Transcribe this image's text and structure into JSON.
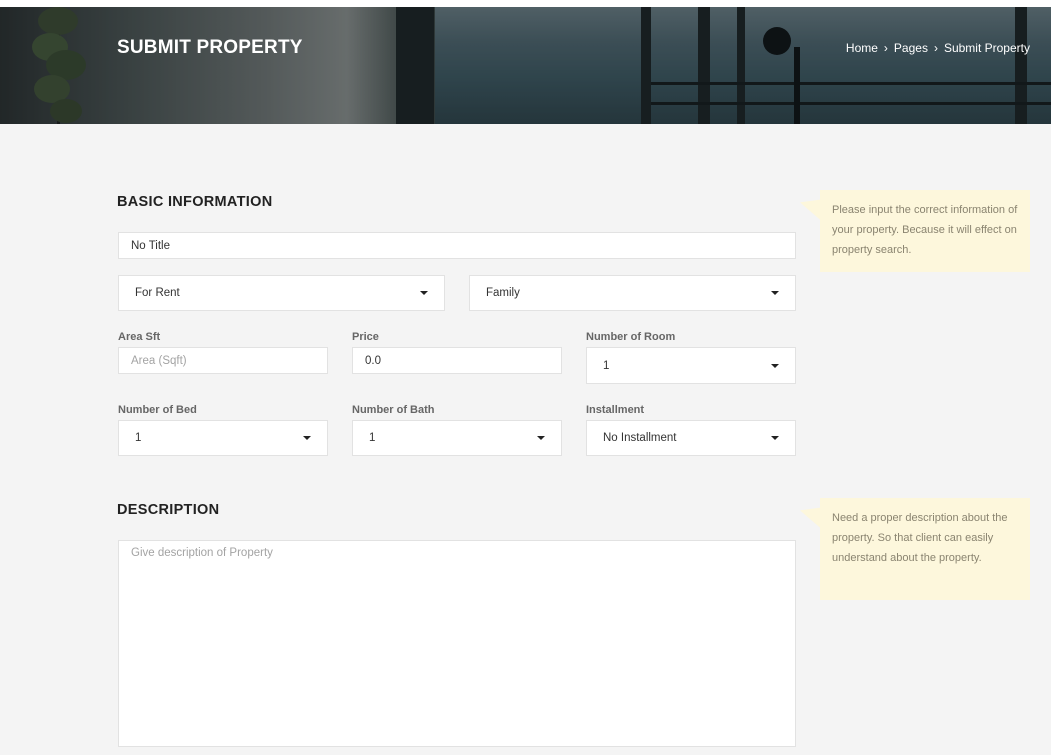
{
  "header": {
    "title": "SUBMIT PROPERTY",
    "breadcrumb": [
      "Home",
      "Pages",
      "Submit Property"
    ]
  },
  "basic": {
    "heading": "BASIC INFORMATION",
    "title_value": "No Title",
    "listing_type": "For Rent",
    "category": "Family",
    "area_label": "Area Sft",
    "area_placeholder": "Area (Sqft)",
    "price_label": "Price",
    "price_value": "0.0",
    "rooms_label": "Number of Room",
    "rooms_value": "1",
    "bed_label": "Number of Bed",
    "bed_value": "1",
    "bath_label": "Number of Bath",
    "bath_value": "1",
    "installment_label": "Installment",
    "installment_value": "No Installment",
    "note": "Please input the correct information of your property. Because it will effect on property search."
  },
  "description": {
    "heading": "DESCRIPTION",
    "placeholder": "Give description of Property",
    "note": "Need a proper description about the property. So that client can easily understand about the property."
  },
  "colors": {
    "background": "#f4f4f4",
    "note_bg": "#fdf7dc",
    "note_text": "#8a8470"
  }
}
